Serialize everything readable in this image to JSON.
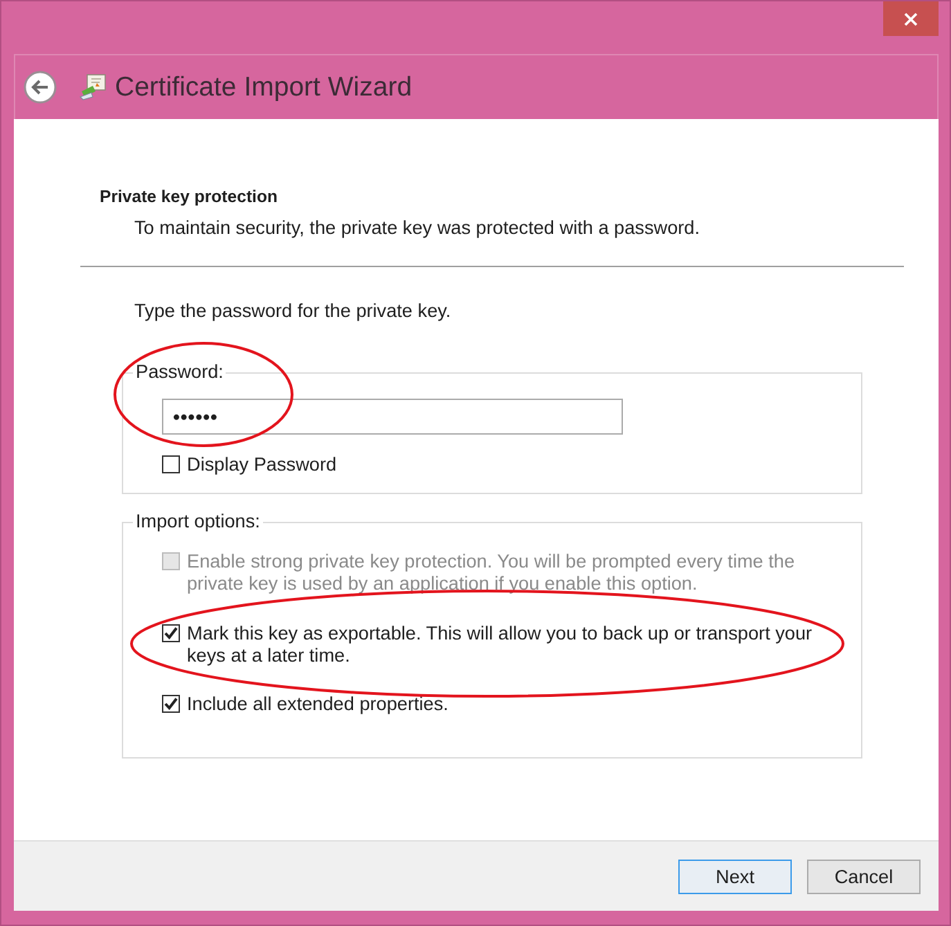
{
  "window": {
    "title": "Certificate Import Wizard"
  },
  "header": {
    "title": "Private key protection",
    "description": "To maintain security, the private key was protected with a password."
  },
  "instruction": "Type the password for the private key.",
  "password_group": {
    "label": "Password:",
    "value": "••••••",
    "display_password": {
      "label": "Display Password",
      "checked": false
    }
  },
  "import_options": {
    "label": "Import options:",
    "options": [
      {
        "label": "Enable strong private key protection. You will be prompted every time the private key is used by an application if you enable this option.",
        "checked": false,
        "disabled": true
      },
      {
        "label": "Mark this key as exportable. This will allow you to back up or transport your keys at a later time.",
        "checked": true,
        "disabled": false
      },
      {
        "label": "Include all extended properties.",
        "checked": true,
        "disabled": false
      }
    ]
  },
  "buttons": [
    {
      "label": "Next",
      "focused": true
    },
    {
      "label": "Cancel",
      "focused": false
    }
  ]
}
